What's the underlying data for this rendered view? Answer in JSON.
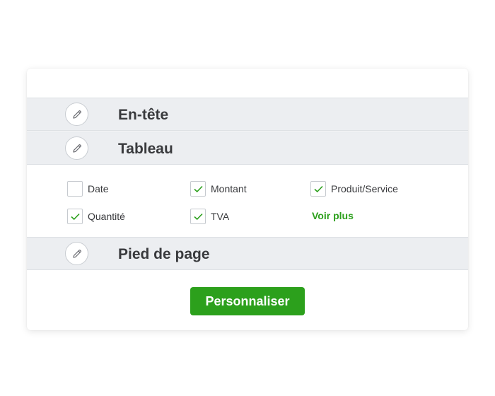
{
  "sections": {
    "header_label": "En-tête",
    "table_label": "Tableau",
    "footer_label": "Pied de page"
  },
  "table_options": [
    {
      "label": "Date",
      "checked": false
    },
    {
      "label": "Montant",
      "checked": true
    },
    {
      "label": "Produit/Service",
      "checked": true
    },
    {
      "label": "Quantité",
      "checked": true
    },
    {
      "label": "TVA",
      "checked": true
    }
  ],
  "more_link": "Voir plus",
  "customize_button": "Personnaliser",
  "colors": {
    "accent": "#2ca01c",
    "section_bg": "#eceef1",
    "text": "#393a3d"
  },
  "icons": {
    "edit": "pencil-icon",
    "check": "checkmark-icon"
  }
}
